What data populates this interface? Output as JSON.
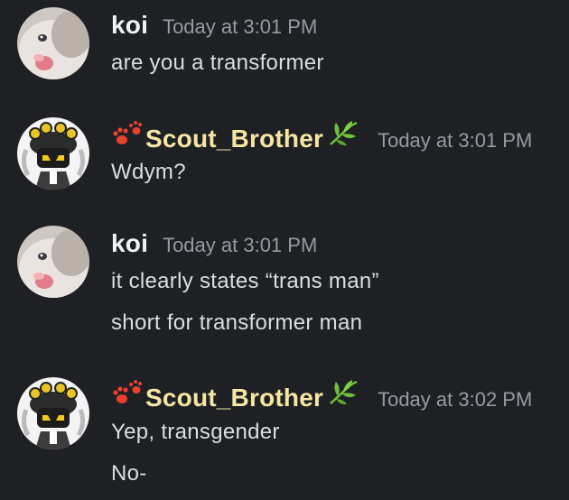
{
  "messages": [
    {
      "author": "koi",
      "avatar_icon": "cat-avatar-icon",
      "timestamp": "Today at 3:01 PM",
      "lines": [
        "are you a transformer"
      ]
    },
    {
      "author": "Scout_Brother",
      "avatar_icon": "robot-avatar-icon",
      "name_color": "#f6e6a4",
      "prefix_icon": "paw-print-icon",
      "suffix_icon": "leaf-icon",
      "timestamp": "Today at 3:01 PM",
      "lines": [
        "Wdym?"
      ]
    },
    {
      "author": "koi",
      "avatar_icon": "cat-avatar-icon",
      "timestamp": "Today at 3:01 PM",
      "lines": [
        "it clearly states “trans man”",
        "short for transformer man"
      ]
    },
    {
      "author": "Scout_Brother",
      "avatar_icon": "robot-avatar-icon",
      "name_color": "#f6e6a4",
      "prefix_icon": "paw-print-icon",
      "suffix_icon": "leaf-icon",
      "timestamp": "Today at 3:02 PM",
      "lines": [
        "Yep, transgender",
        "No-"
      ]
    }
  ],
  "colors": {
    "background": "#1f2024",
    "text": "#dbdee1",
    "muted": "#949ba4",
    "scout_name": "#f6e6a4"
  }
}
